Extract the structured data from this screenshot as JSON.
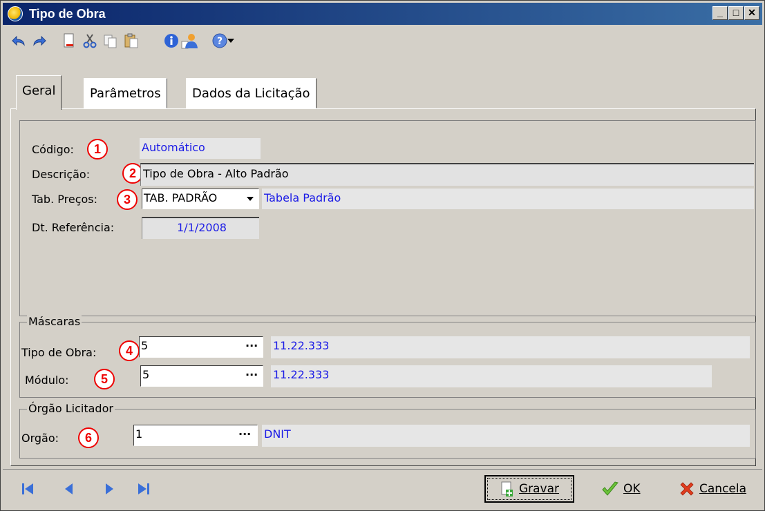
{
  "window": {
    "title": "Tipo de Obra"
  },
  "tabs": [
    {
      "label": "Geral"
    },
    {
      "label": "Parâmetros"
    },
    {
      "label": "Dados da Licitação"
    }
  ],
  "general": {
    "codigo_label": "Código:",
    "codigo_value": "Automático",
    "descricao_label": "Descrição:",
    "descricao_value": "Tipo de Obra - Alto Padrão",
    "tab_precos_label": "Tab. Preços:",
    "tab_precos_value": "TAB. PADRÃO",
    "tab_precos_desc": "Tabela Padrão",
    "dt_ref_label": "Dt. Referência:",
    "dt_ref_value": "1/1/2008"
  },
  "mascaras": {
    "group_label": "Máscaras",
    "tipo_obra_label": "Tipo de Obra:",
    "tipo_obra_value": "5",
    "tipo_obra_mask": "11.22.333",
    "modulo_label": "Módulo:",
    "modulo_value": "5",
    "modulo_mask": "11.22.333"
  },
  "orgao": {
    "group_label": "Órgão Licitador",
    "orgao_label": "Orgão:",
    "orgao_value": "1",
    "orgao_name": "DNIT"
  },
  "badges": [
    "1",
    "2",
    "3",
    "4",
    "5",
    "6"
  ],
  "buttons": {
    "ellipsis": "···",
    "gravar": "Gravar",
    "ok": "OK",
    "cancela": "Cancela"
  },
  "icons": [
    "undo-icon",
    "redo-icon",
    "new-document-icon",
    "cut-icon",
    "copy-icon",
    "paste-icon",
    "info-icon",
    "user-icon",
    "help-icon",
    "dropdown-arrow-icon",
    "first-record-icon",
    "previous-record-icon",
    "next-record-icon",
    "last-record-icon",
    "save-icon",
    "check-icon",
    "cancel-x-icon"
  ],
  "colors": {
    "title_bar": "#0a246a",
    "value_text": "#1a1ae6",
    "badge": "#e00000",
    "ok_check": "#6cc23a",
    "cancel_x": "#e03c1e"
  }
}
